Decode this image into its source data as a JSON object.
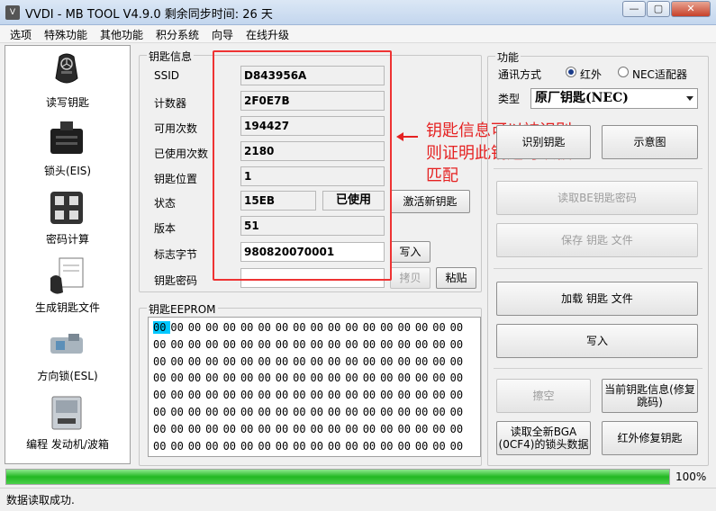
{
  "window": {
    "title": "VVDI - MB TOOL V4.9.0   剩余同步时间: 26 天",
    "minimize": "—",
    "maximize": "▢",
    "close": "✕"
  },
  "menu": [
    "选项",
    "特殊功能",
    "其他功能",
    "积分系统",
    "向导",
    "在线升级"
  ],
  "sidebar": [
    {
      "label": "读写钥匙",
      "icon": "car-key-icon"
    },
    {
      "label": "锁头(EIS)",
      "icon": "ignition-lock-icon"
    },
    {
      "label": "密码计算",
      "icon": "keypad-icon"
    },
    {
      "label": "生成钥匙文件",
      "icon": "key-file-icon"
    },
    {
      "label": "方向锁(ESL)",
      "icon": "steering-lock-icon"
    },
    {
      "label": "编程 发动机/波箱",
      "icon": "ecu-module-icon"
    }
  ],
  "key_info": {
    "title": "钥匙信息",
    "ssid_label": "SSID",
    "ssid": "D843956A",
    "counter_label": "计数器",
    "counter": "2F0E7B",
    "available_label": "可用次数",
    "available": "194427",
    "used_label": "已使用次数",
    "used": "2180",
    "position_label": "钥匙位置",
    "position": "1",
    "status_label": "状态",
    "status": "15EB",
    "status_badge": "已使用",
    "activate_button": "激活新钥匙",
    "version_label": "版本",
    "version": "51",
    "flag_label": "标志字节",
    "flag": "980820070001",
    "write_button": "写入",
    "password_label": "钥匙密码",
    "password": "",
    "copy_button": "拷贝",
    "paste_button": "粘贴"
  },
  "eeprom": {
    "title": "钥匙EEPROM",
    "byte": "00",
    "rows": 8,
    "cols": 18
  },
  "annotation": {
    "line1": "钥匙信息可以被识别",
    "line2": "则证明此钥匙可以被",
    "line3": "匹配",
    "color": "#e52222"
  },
  "function": {
    "title": "功能",
    "comm_label": "通讯方式",
    "radio_ir": "红外",
    "radio_nec": "NEC适配器",
    "type_label": "类型",
    "type_value": "原厂钥匙(NEC)",
    "identify_button": "识别钥匙",
    "diagram_button": "示意图",
    "read_be_password_button": "读取BE钥匙密码",
    "save_key_file_button": "保存 钥匙 文件",
    "load_key_file_button": "加载 钥匙 文件",
    "write_button": "写入",
    "erase_button": "擦空",
    "repair_button": "当前钥匙信息(修复跳码)",
    "read_bga_button": "读取全新BGA (0CF4)的锁头数据",
    "ir_repair_button": "红外修复钥匙"
  },
  "progress": {
    "percent": 100,
    "text": "100%"
  },
  "status": "数据读取成功."
}
